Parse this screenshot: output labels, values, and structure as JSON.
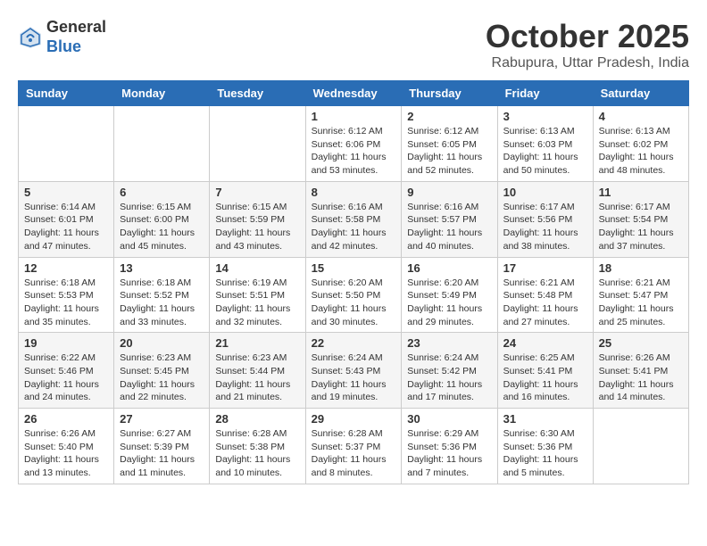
{
  "header": {
    "logo_line1": "General",
    "logo_line2": "Blue",
    "month_title": "October 2025",
    "location": "Rabupura, Uttar Pradesh, India"
  },
  "days_of_week": [
    "Sunday",
    "Monday",
    "Tuesday",
    "Wednesday",
    "Thursday",
    "Friday",
    "Saturday"
  ],
  "weeks": [
    [
      {
        "day": "",
        "sunrise": "",
        "sunset": "",
        "daylight": ""
      },
      {
        "day": "",
        "sunrise": "",
        "sunset": "",
        "daylight": ""
      },
      {
        "day": "",
        "sunrise": "",
        "sunset": "",
        "daylight": ""
      },
      {
        "day": "1",
        "sunrise": "Sunrise: 6:12 AM",
        "sunset": "Sunset: 6:06 PM",
        "daylight": "Daylight: 11 hours and 53 minutes."
      },
      {
        "day": "2",
        "sunrise": "Sunrise: 6:12 AM",
        "sunset": "Sunset: 6:05 PM",
        "daylight": "Daylight: 11 hours and 52 minutes."
      },
      {
        "day": "3",
        "sunrise": "Sunrise: 6:13 AM",
        "sunset": "Sunset: 6:03 PM",
        "daylight": "Daylight: 11 hours and 50 minutes."
      },
      {
        "day": "4",
        "sunrise": "Sunrise: 6:13 AM",
        "sunset": "Sunset: 6:02 PM",
        "daylight": "Daylight: 11 hours and 48 minutes."
      }
    ],
    [
      {
        "day": "5",
        "sunrise": "Sunrise: 6:14 AM",
        "sunset": "Sunset: 6:01 PM",
        "daylight": "Daylight: 11 hours and 47 minutes."
      },
      {
        "day": "6",
        "sunrise": "Sunrise: 6:15 AM",
        "sunset": "Sunset: 6:00 PM",
        "daylight": "Daylight: 11 hours and 45 minutes."
      },
      {
        "day": "7",
        "sunrise": "Sunrise: 6:15 AM",
        "sunset": "Sunset: 5:59 PM",
        "daylight": "Daylight: 11 hours and 43 minutes."
      },
      {
        "day": "8",
        "sunrise": "Sunrise: 6:16 AM",
        "sunset": "Sunset: 5:58 PM",
        "daylight": "Daylight: 11 hours and 42 minutes."
      },
      {
        "day": "9",
        "sunrise": "Sunrise: 6:16 AM",
        "sunset": "Sunset: 5:57 PM",
        "daylight": "Daylight: 11 hours and 40 minutes."
      },
      {
        "day": "10",
        "sunrise": "Sunrise: 6:17 AM",
        "sunset": "Sunset: 5:56 PM",
        "daylight": "Daylight: 11 hours and 38 minutes."
      },
      {
        "day": "11",
        "sunrise": "Sunrise: 6:17 AM",
        "sunset": "Sunset: 5:54 PM",
        "daylight": "Daylight: 11 hours and 37 minutes."
      }
    ],
    [
      {
        "day": "12",
        "sunrise": "Sunrise: 6:18 AM",
        "sunset": "Sunset: 5:53 PM",
        "daylight": "Daylight: 11 hours and 35 minutes."
      },
      {
        "day": "13",
        "sunrise": "Sunrise: 6:18 AM",
        "sunset": "Sunset: 5:52 PM",
        "daylight": "Daylight: 11 hours and 33 minutes."
      },
      {
        "day": "14",
        "sunrise": "Sunrise: 6:19 AM",
        "sunset": "Sunset: 5:51 PM",
        "daylight": "Daylight: 11 hours and 32 minutes."
      },
      {
        "day": "15",
        "sunrise": "Sunrise: 6:20 AM",
        "sunset": "Sunset: 5:50 PM",
        "daylight": "Daylight: 11 hours and 30 minutes."
      },
      {
        "day": "16",
        "sunrise": "Sunrise: 6:20 AM",
        "sunset": "Sunset: 5:49 PM",
        "daylight": "Daylight: 11 hours and 29 minutes."
      },
      {
        "day": "17",
        "sunrise": "Sunrise: 6:21 AM",
        "sunset": "Sunset: 5:48 PM",
        "daylight": "Daylight: 11 hours and 27 minutes."
      },
      {
        "day": "18",
        "sunrise": "Sunrise: 6:21 AM",
        "sunset": "Sunset: 5:47 PM",
        "daylight": "Daylight: 11 hours and 25 minutes."
      }
    ],
    [
      {
        "day": "19",
        "sunrise": "Sunrise: 6:22 AM",
        "sunset": "Sunset: 5:46 PM",
        "daylight": "Daylight: 11 hours and 24 minutes."
      },
      {
        "day": "20",
        "sunrise": "Sunrise: 6:23 AM",
        "sunset": "Sunset: 5:45 PM",
        "daylight": "Daylight: 11 hours and 22 minutes."
      },
      {
        "day": "21",
        "sunrise": "Sunrise: 6:23 AM",
        "sunset": "Sunset: 5:44 PM",
        "daylight": "Daylight: 11 hours and 21 minutes."
      },
      {
        "day": "22",
        "sunrise": "Sunrise: 6:24 AM",
        "sunset": "Sunset: 5:43 PM",
        "daylight": "Daylight: 11 hours and 19 minutes."
      },
      {
        "day": "23",
        "sunrise": "Sunrise: 6:24 AM",
        "sunset": "Sunset: 5:42 PM",
        "daylight": "Daylight: 11 hours and 17 minutes."
      },
      {
        "day": "24",
        "sunrise": "Sunrise: 6:25 AM",
        "sunset": "Sunset: 5:41 PM",
        "daylight": "Daylight: 11 hours and 16 minutes."
      },
      {
        "day": "25",
        "sunrise": "Sunrise: 6:26 AM",
        "sunset": "Sunset: 5:41 PM",
        "daylight": "Daylight: 11 hours and 14 minutes."
      }
    ],
    [
      {
        "day": "26",
        "sunrise": "Sunrise: 6:26 AM",
        "sunset": "Sunset: 5:40 PM",
        "daylight": "Daylight: 11 hours and 13 minutes."
      },
      {
        "day": "27",
        "sunrise": "Sunrise: 6:27 AM",
        "sunset": "Sunset: 5:39 PM",
        "daylight": "Daylight: 11 hours and 11 minutes."
      },
      {
        "day": "28",
        "sunrise": "Sunrise: 6:28 AM",
        "sunset": "Sunset: 5:38 PM",
        "daylight": "Daylight: 11 hours and 10 minutes."
      },
      {
        "day": "29",
        "sunrise": "Sunrise: 6:28 AM",
        "sunset": "Sunset: 5:37 PM",
        "daylight": "Daylight: 11 hours and 8 minutes."
      },
      {
        "day": "30",
        "sunrise": "Sunrise: 6:29 AM",
        "sunset": "Sunset: 5:36 PM",
        "daylight": "Daylight: 11 hours and 7 minutes."
      },
      {
        "day": "31",
        "sunrise": "Sunrise: 6:30 AM",
        "sunset": "Sunset: 5:36 PM",
        "daylight": "Daylight: 11 hours and 5 minutes."
      },
      {
        "day": "",
        "sunrise": "",
        "sunset": "",
        "daylight": ""
      }
    ]
  ]
}
